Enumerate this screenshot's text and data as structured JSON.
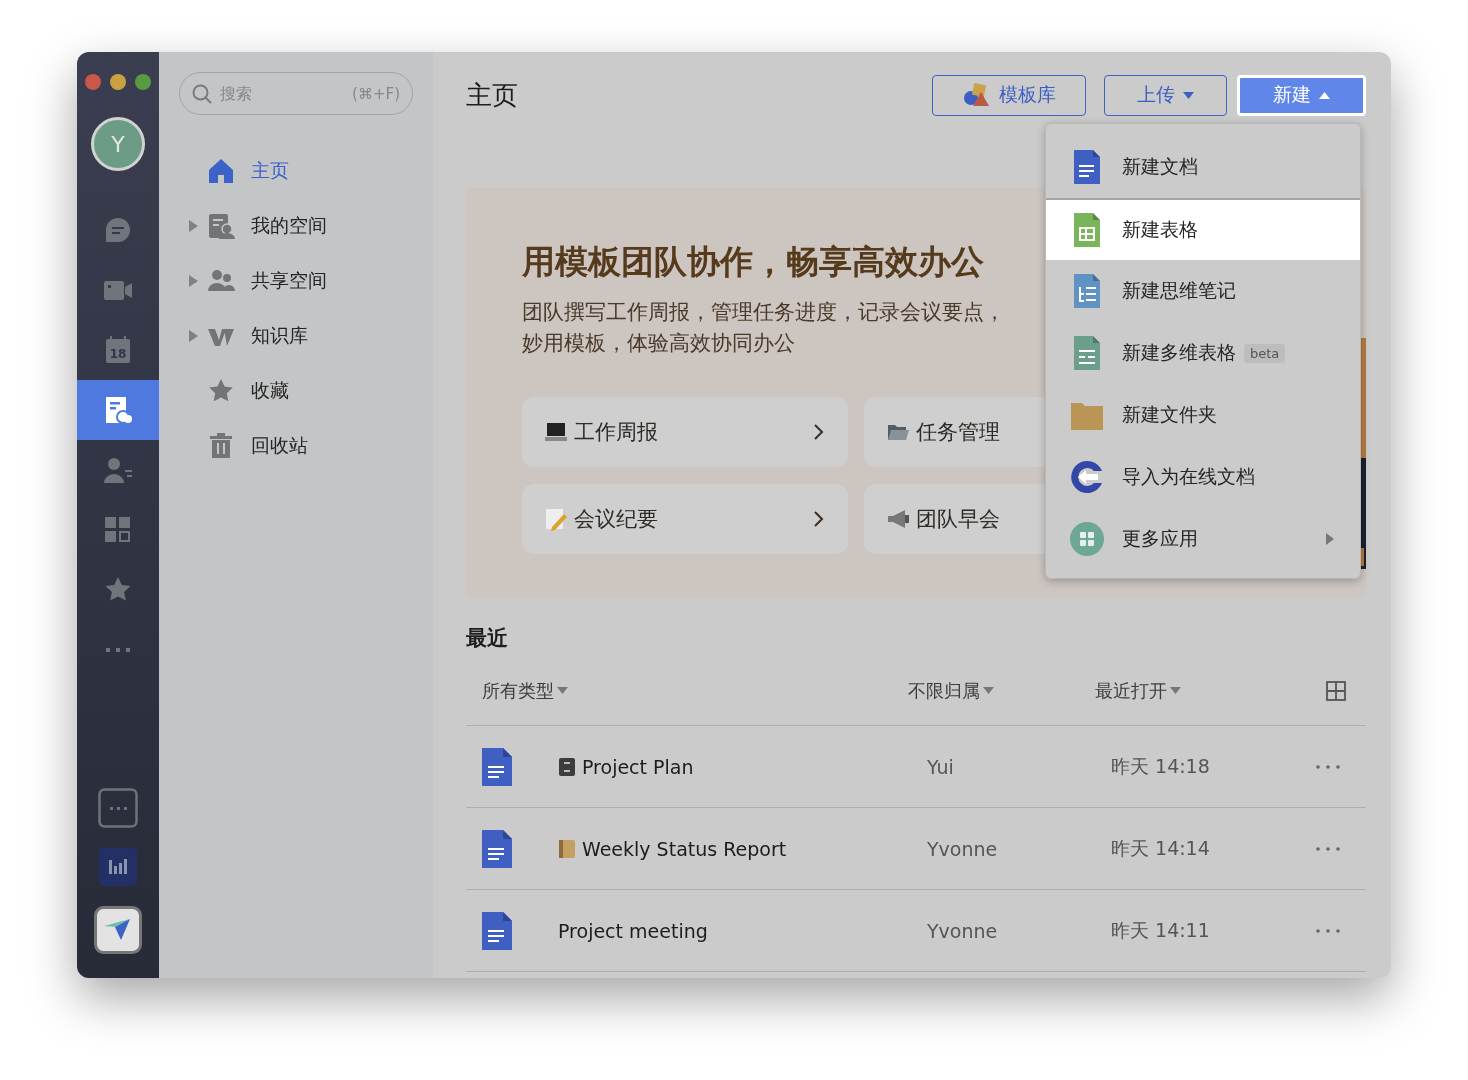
{
  "rail": {
    "avatar": "Y",
    "items": [
      {
        "kind": "chat",
        "selected": false
      },
      {
        "kind": "video",
        "selected": false
      },
      {
        "kind": "calendar",
        "selected": false,
        "text": "18"
      },
      {
        "kind": "docs",
        "selected": true
      },
      {
        "kind": "contacts",
        "selected": false
      },
      {
        "kind": "apps",
        "selected": false
      },
      {
        "kind": "star",
        "selected": false
      },
      {
        "kind": "more",
        "selected": false
      }
    ],
    "bottom": [
      {
        "kind": "more-box"
      },
      {
        "kind": "chart"
      },
      {
        "kind": "send"
      }
    ]
  },
  "sidebar": {
    "search": {
      "placeholder": "搜索",
      "shortcut": "(⌘+F)"
    },
    "items": [
      {
        "label": "主页",
        "kind": "home",
        "expandable": false,
        "selected": true
      },
      {
        "label": "我的空间",
        "kind": "my-space",
        "expandable": true,
        "selected": false
      },
      {
        "label": "共享空间",
        "kind": "people",
        "expandable": true,
        "selected": false
      },
      {
        "label": "知识库",
        "kind": "wiki",
        "expandable": true,
        "selected": false
      },
      {
        "label": "收藏",
        "kind": "star",
        "expandable": false,
        "selected": false
      },
      {
        "label": "回收站",
        "kind": "trash",
        "expandable": false,
        "selected": false
      }
    ]
  },
  "header": {
    "title": "主页",
    "buttons": [
      {
        "label": "模板库",
        "kind": "template"
      },
      {
        "label": "上传",
        "kind": "dropdown",
        "expanded": false
      },
      {
        "label": "新建",
        "kind": "primary",
        "expanded": true
      }
    ]
  },
  "banner": {
    "title": "用模板团队协作，畅享高效办公",
    "lines": [
      "团队撰写工作周报，管理任务进度，记录会议要点，",
      "妙用模板，体验高效协同办公"
    ],
    "cards": [
      {
        "label": "工作周报",
        "kind": "laptop",
        "chevron": true
      },
      {
        "label": "任务管理",
        "kind": "folder"
      },
      {
        "label": "会议纪要",
        "kind": "memo",
        "chevron": true
      },
      {
        "label": "团队早会",
        "kind": "megaphone"
      }
    ]
  },
  "menu": {
    "items": [
      {
        "label": "新建文档",
        "kind": "doc",
        "selected": false
      },
      {
        "label": "新建表格",
        "kind": "sheet",
        "selected": true
      },
      {
        "label": "新建思维笔记",
        "kind": "mind",
        "selected": false
      },
      {
        "label": "新建多维表格",
        "kind": "table",
        "selected": false,
        "badge": "beta"
      },
      {
        "label": "新建文件夹",
        "kind": "folder",
        "selected": false
      },
      {
        "label": "导入为在线文档",
        "kind": "import",
        "selected": false
      },
      {
        "label": "更多应用",
        "kind": "apps",
        "selected": false,
        "submenu": true
      }
    ]
  },
  "recent": {
    "title": "最近",
    "filters": [
      "所有类型",
      "不限归属",
      "最近打开"
    ],
    "rows": [
      {
        "name": "Project Plan",
        "kind": "cabinet",
        "owner": "Yui",
        "time": "昨天 14:18"
      },
      {
        "name": "Weekly Status Report",
        "kind": "notebook",
        "owner": "Yvonne",
        "time": "昨天 14:14"
      },
      {
        "name": "Project meeting",
        "owner": "Yvonne",
        "time": "昨天 14:11"
      }
    ]
  }
}
